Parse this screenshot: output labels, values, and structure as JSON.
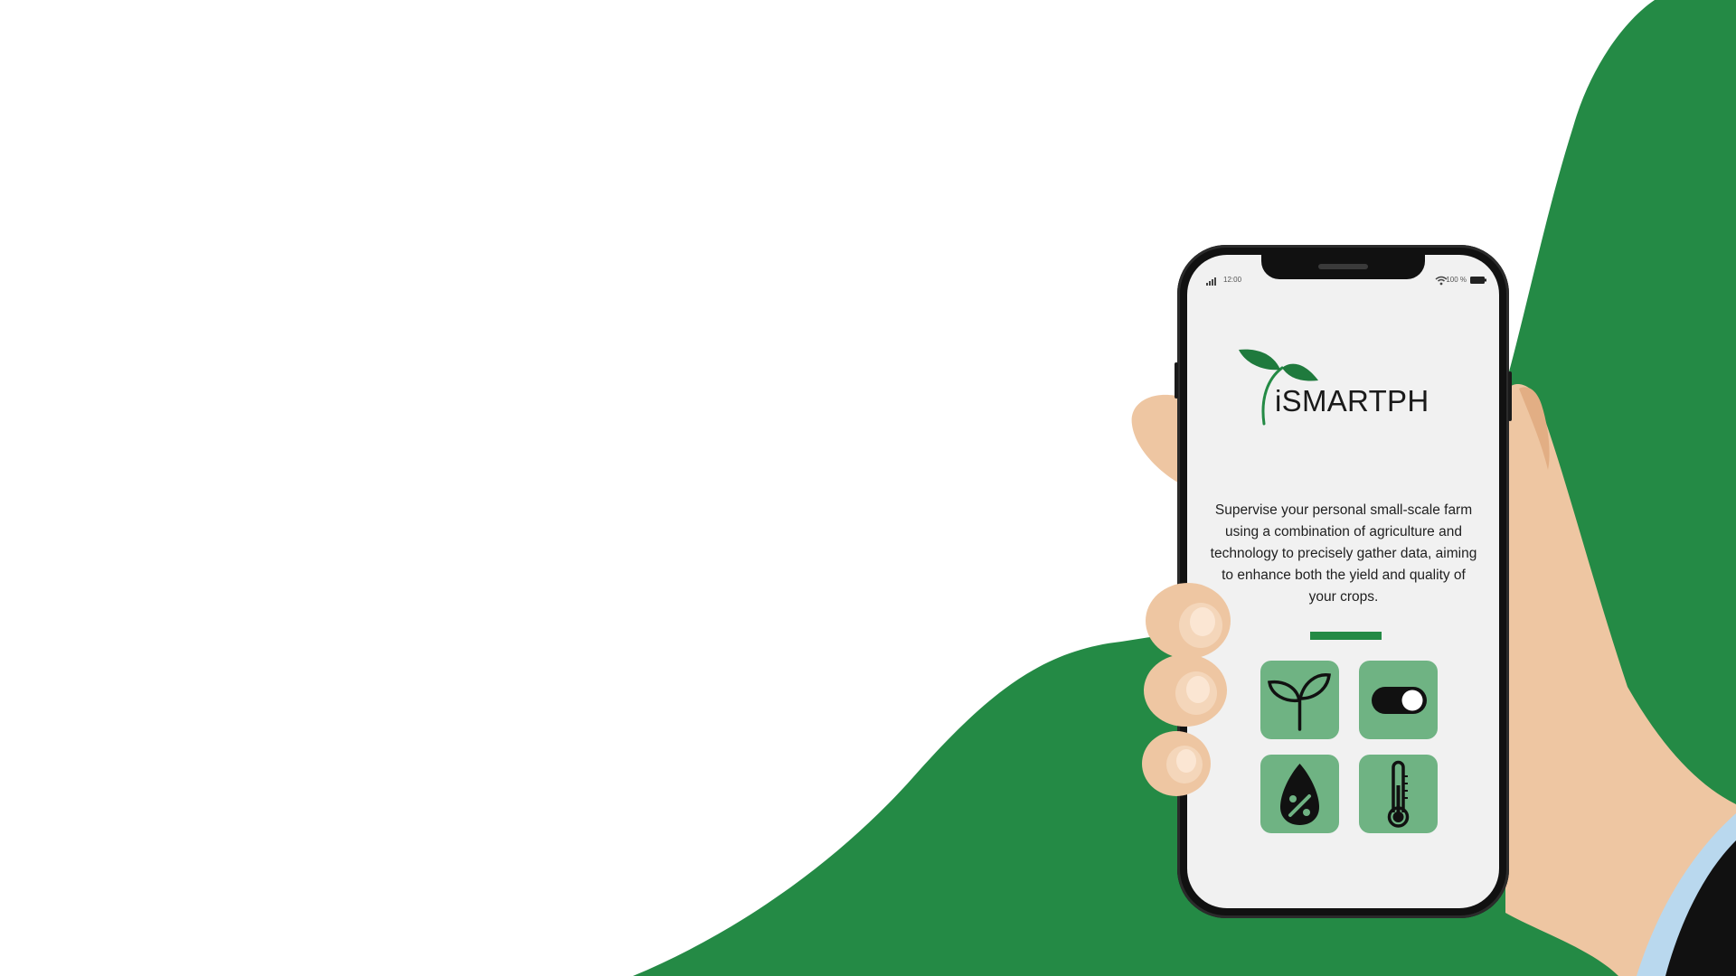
{
  "app": {
    "brand_name": "iSMARTPH",
    "description": "Supervise your personal small-scale farm using a combination of agriculture and technology to precisely gather data, aiming to enhance both the yield and quality of your crops."
  },
  "status_bar": {
    "time": "12:00",
    "battery": "100 %"
  },
  "feature_tiles": [
    {
      "icon": "sprout-icon"
    },
    {
      "icon": "toggle-switch-icon"
    },
    {
      "icon": "humidity-drop-icon"
    },
    {
      "icon": "thermometer-icon"
    }
  ],
  "colors": {
    "brand_green": "#248a45",
    "tile_green": "#6fb383",
    "skin": "#eec6a2"
  }
}
